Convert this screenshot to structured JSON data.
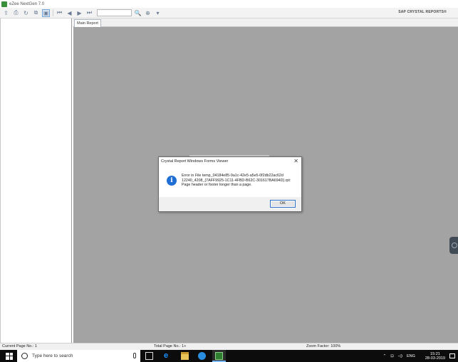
{
  "window": {
    "title": "eZee NextGen 7.0"
  },
  "toolbar": {
    "page_input_value": "",
    "brand": "SAP CRYSTAL REPORTS®"
  },
  "tabs": [
    {
      "label": "Main Report"
    }
  ],
  "status": {
    "current_page": "Current Page No.: 1",
    "total_page": "Total Page No.: 1+",
    "zoom": "Zoom Factor: 100%"
  },
  "dialog": {
    "title": "Crystal Report Windows Forms Viewer",
    "message_lines": [
      "Error in File temp_04184e85-9a1c-42e5-a5e5-0f2db22ac62d",
      "12240_4208_{7AFF9925-1C11-4FBD-B62C-301617BA694D}.rpt:",
      "Page header or footer longer than a page."
    ],
    "ok_label": "OK"
  },
  "taskbar": {
    "search_placeholder": "Type here to search",
    "language": "ENG",
    "time": "15:21",
    "date": "28-03-2019"
  },
  "colors": {
    "report_bg": "#a3a3a3",
    "info_icon": "#1f6ed4",
    "taskbar": "#0c0c0c"
  }
}
